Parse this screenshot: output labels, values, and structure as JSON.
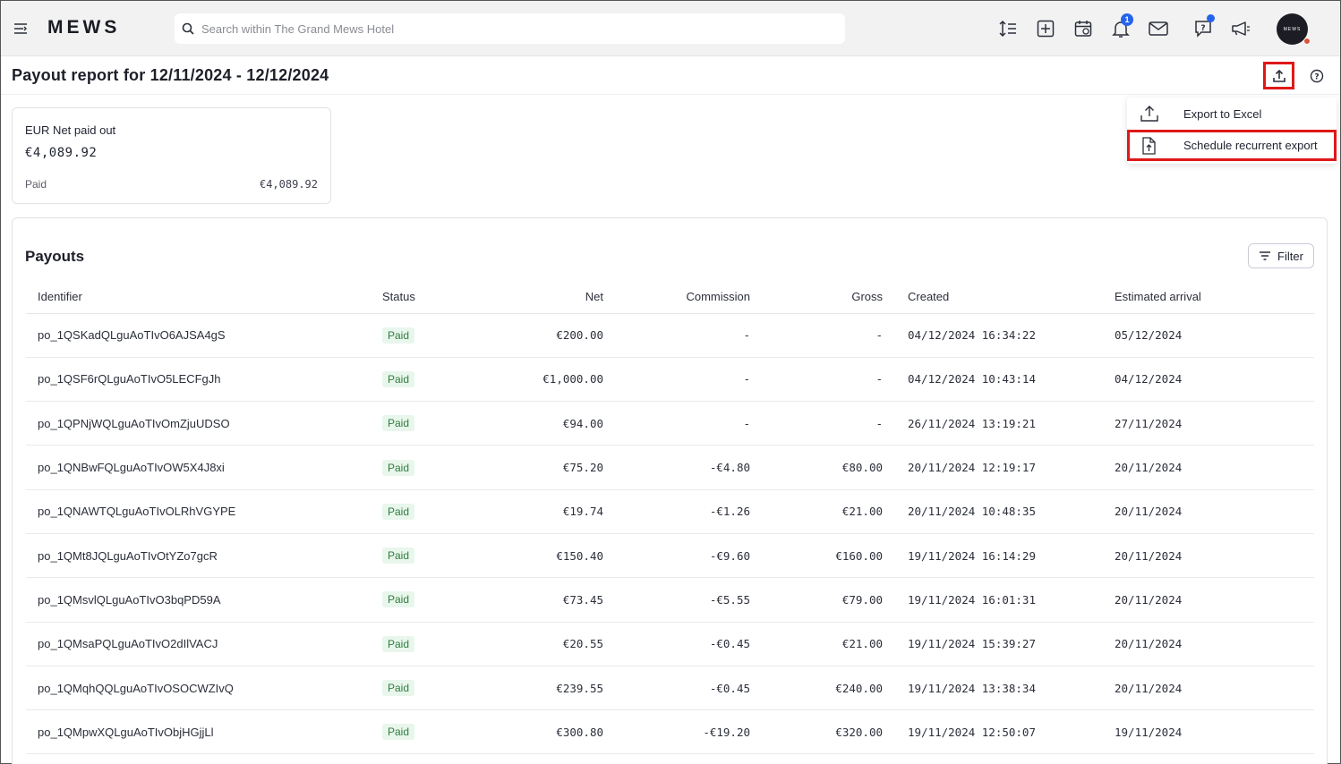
{
  "topbar": {
    "logo": "MEWS",
    "search_placeholder": "Search within The Grand Mews Hotel",
    "notifications_count": "1",
    "avatar_text": "MEWS",
    "icons": [
      "menu-icon",
      "sort-icon",
      "add-icon",
      "calendar-icon",
      "bell-icon",
      "mail-icon",
      "help-chat-icon",
      "megaphone-icon"
    ]
  },
  "header": {
    "title": "Payout report for 12/11/2024 - 12/12/2024"
  },
  "export_menu": {
    "items": [
      {
        "label": "Export to Excel",
        "icon": "upload-icon"
      },
      {
        "label": "Schedule recurrent export",
        "icon": "file-upload-icon"
      }
    ]
  },
  "summary": {
    "title": "EUR Net paid out",
    "amount": "€4,089.92",
    "paid_label": "Paid",
    "paid_value": "€4,089.92"
  },
  "payouts": {
    "title": "Payouts",
    "filter_label": "Filter",
    "columns": [
      "Identifier",
      "Status",
      "Net",
      "Commission",
      "Gross",
      "Created",
      "Estimated arrival"
    ],
    "rows": [
      [
        "po_1QSKadQLguAoTIvO6AJSA4gS",
        "Paid",
        "€200.00",
        "-",
        "-",
        "04/12/2024 16:34:22",
        "05/12/2024"
      ],
      [
        "po_1QSF6rQLguAoTIvO5LECFgJh",
        "Paid",
        "€1,000.00",
        "-",
        "-",
        "04/12/2024 10:43:14",
        "04/12/2024"
      ],
      [
        "po_1QPNjWQLguAoTIvOmZjuUDSO",
        "Paid",
        "€94.00",
        "-",
        "-",
        "26/11/2024 13:19:21",
        "27/11/2024"
      ],
      [
        "po_1QNBwFQLguAoTIvOW5X4J8xi",
        "Paid",
        "€75.20",
        "-€4.80",
        "€80.00",
        "20/11/2024 12:19:17",
        "20/11/2024"
      ],
      [
        "po_1QNAWTQLguAoTIvOLRhVGYPE",
        "Paid",
        "€19.74",
        "-€1.26",
        "€21.00",
        "20/11/2024 10:48:35",
        "20/11/2024"
      ],
      [
        "po_1QMt8JQLguAoTIvOtYZo7gcR",
        "Paid",
        "€150.40",
        "-€9.60",
        "€160.00",
        "19/11/2024 16:14:29",
        "20/11/2024"
      ],
      [
        "po_1QMsvlQLguAoTIvO3bqPD59A",
        "Paid",
        "€73.45",
        "-€5.55",
        "€79.00",
        "19/11/2024 16:01:31",
        "20/11/2024"
      ],
      [
        "po_1QMsaPQLguAoTIvO2dIlVACJ",
        "Paid",
        "€20.55",
        "-€0.45",
        "€21.00",
        "19/11/2024 15:39:27",
        "20/11/2024"
      ],
      [
        "po_1QMqhQQLguAoTIvOSOCWZIvQ",
        "Paid",
        "€239.55",
        "-€0.45",
        "€240.00",
        "19/11/2024 13:38:34",
        "20/11/2024"
      ],
      [
        "po_1QMpwXQLguAoTIvObjHGjjLl",
        "Paid",
        "€300.80",
        "-€19.20",
        "€320.00",
        "19/11/2024 12:50:07",
        "19/11/2024"
      ]
    ]
  },
  "colors": {
    "highlight": "#e01818",
    "badge": "#2563eb",
    "paid_bg": "#e9f6ec",
    "paid_text": "#2e7d40"
  }
}
